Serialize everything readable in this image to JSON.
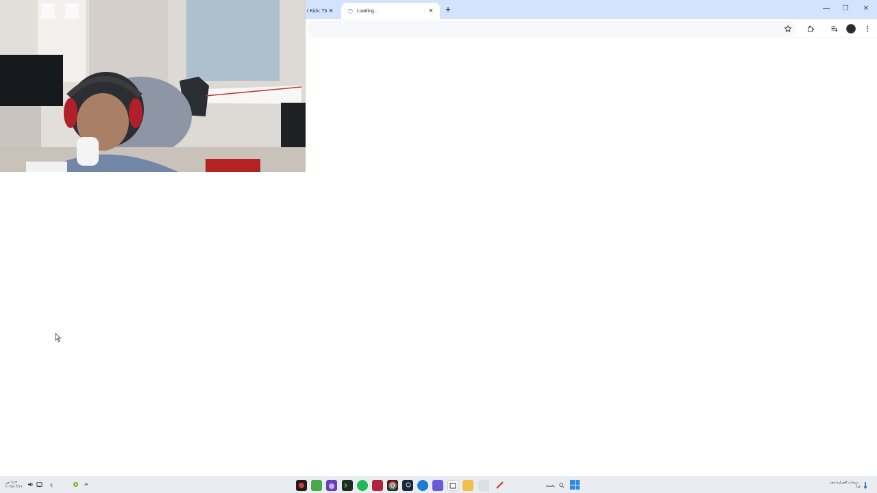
{
  "browser": {
    "tabs": [
      {
        "label": "r Kick: Th",
        "state": "inactive"
      },
      {
        "label": "Loading...",
        "state": "active-loading"
      }
    ],
    "new_tab_label": "+",
    "tab_close_glyph": "×",
    "window_controls": {
      "minimize": "—",
      "restore": "❐",
      "close": "✕"
    },
    "toolbar_icons": [
      "bookmark-star-icon",
      "extensions-icon",
      "reading-list-icon",
      "profile-avatar",
      "kebab-menu-icon"
    ]
  },
  "webcam": {
    "type": "live webcam overlay"
  },
  "taskbar": {
    "weather": {
      "line1": "درجات الحرارة تتحد...",
      "line2": "غداً"
    },
    "search_placeholder": "بحث",
    "clock": {
      "time": "٦:٤٣ ص",
      "date": "٢٠٢٥/٠٣/١٦"
    },
    "lang_indicator": "ع",
    "accent": "#2e8ae6",
    "background": "#e9ecf0"
  }
}
